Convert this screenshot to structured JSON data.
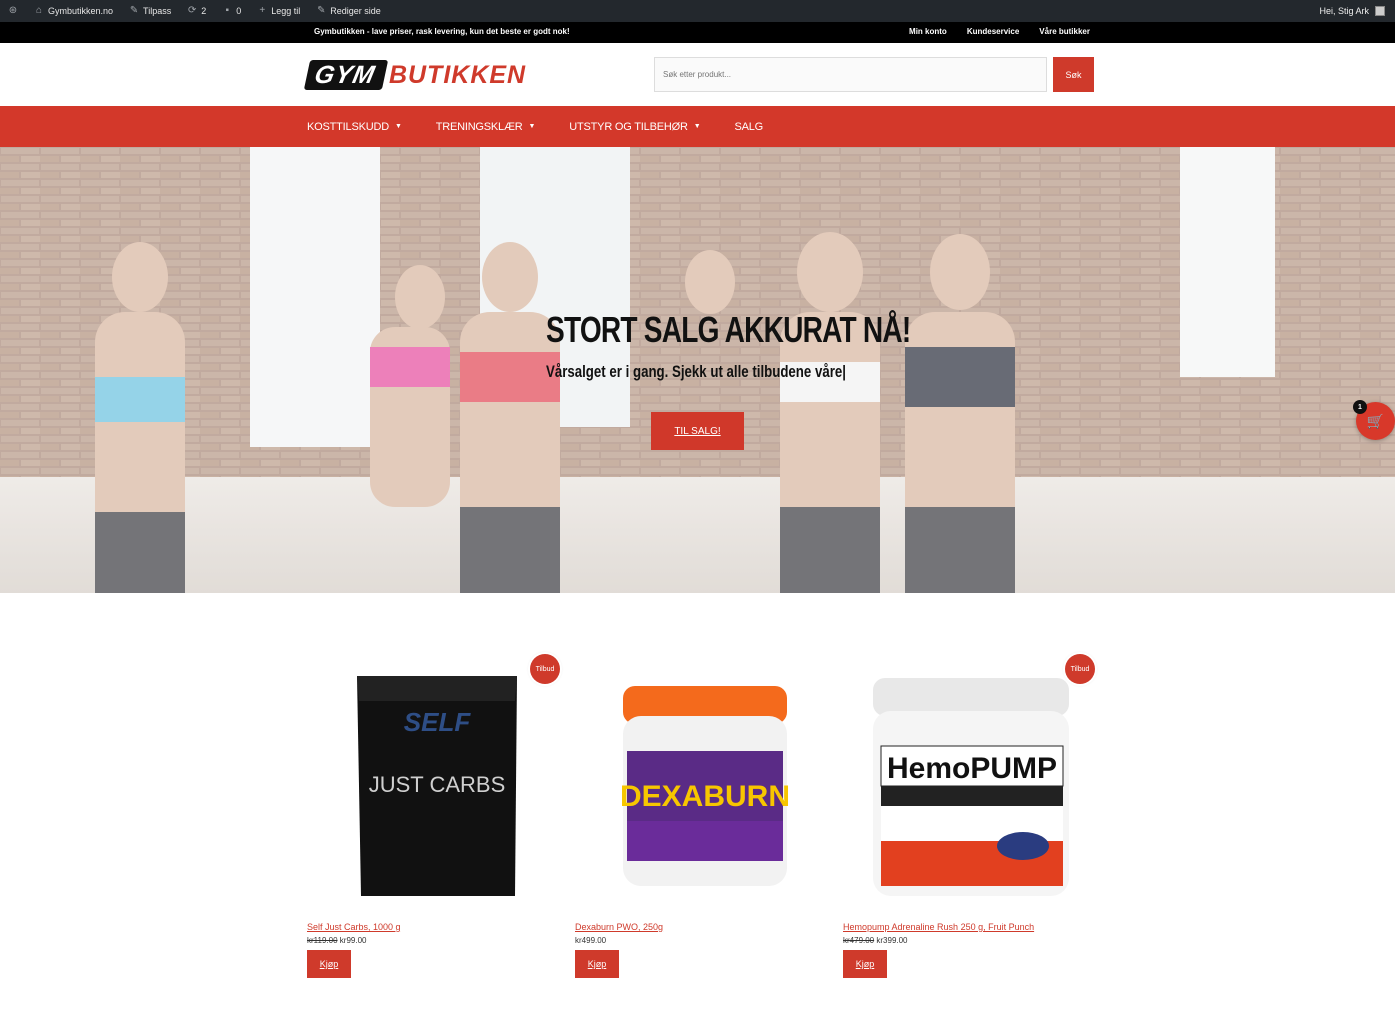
{
  "adminbar": {
    "site": "Gymbutikken.no",
    "customize": "Tilpass",
    "updates_count": "2",
    "comments_count": "0",
    "add_new": "Legg til",
    "edit_page": "Rediger side",
    "greeting": "Hei, Stig Ark"
  },
  "topbar": {
    "tagline": "Gymbutikken - lave priser, rask levering, kun det beste er godt nok!",
    "links": [
      "Min konto",
      "Kundeservice",
      "Våre butikker"
    ]
  },
  "header": {
    "logo_part1": "GYM",
    "logo_part2": "BUTIKKEN",
    "search_placeholder": "Søk etter produkt...",
    "search_button": "Søk"
  },
  "nav": {
    "items": [
      "KOSTTILSKUDD",
      "TRENINGSKLÆR",
      "UTSTYR OG TILBEHØR",
      "SALG"
    ]
  },
  "hero": {
    "title": "STORT SALG AKKURAT NÅ!",
    "subtitle": "Vårsalget er i gang. Sjekk ut alle tilbudene våre|",
    "cta": "TIL SALG!"
  },
  "cart": {
    "count": "1"
  },
  "products": [
    {
      "name": "Self Just Carbs, 1000 g",
      "old_price": "kr119.00",
      "price": "kr99.00",
      "badge": "Tilbud",
      "buy": "Kjøp",
      "image_text": "JUST CARBS"
    },
    {
      "name": "Dexaburn PWO, 250g",
      "old_price": "",
      "price": "kr499.00",
      "badge": "",
      "buy": "Kjøp",
      "image_text": "DEXABURN"
    },
    {
      "name": "Hemopump Adrenaline Rush 250 g, Fruit Punch",
      "old_price": "kr479.00",
      "price": "kr399.00",
      "badge": "Tilbud",
      "buy": "Kjøp",
      "image_text": "HemoPUMP"
    }
  ],
  "colors": {
    "brand_red": "#cf3a2b",
    "admin_bar": "#23282d",
    "top_bar": "#000000"
  }
}
